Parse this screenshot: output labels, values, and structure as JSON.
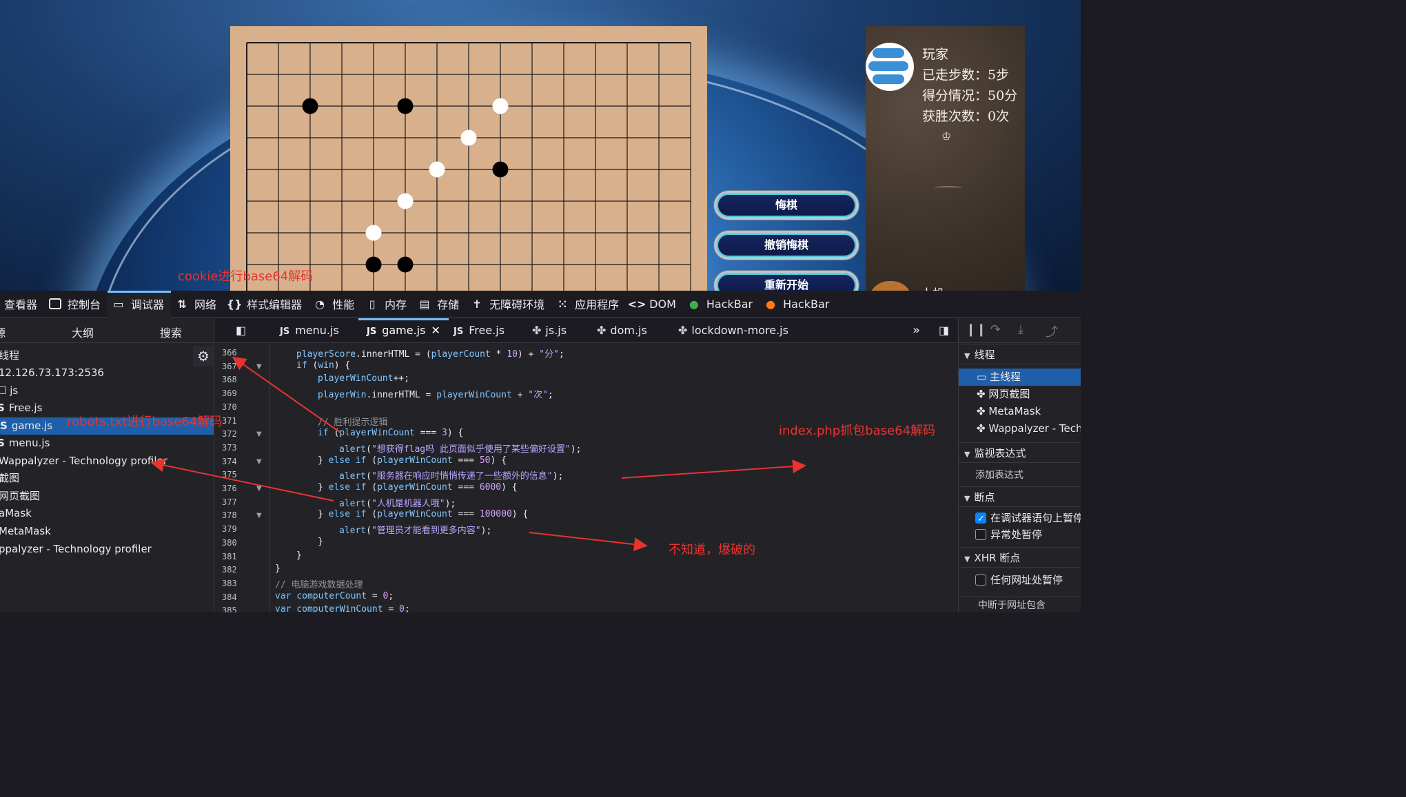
{
  "game": {
    "player_stats": {
      "title": "玩家",
      "steps": "已走步数：5步",
      "score": "得分情况：50分",
      "wins": "获胜次数：0次",
      "ai_label": "人机"
    },
    "buttons": {
      "undo": "悔棋",
      "cancel_undo": "撤销悔棋",
      "restart": "重新开始"
    },
    "board": {
      "grid_lines": 15,
      "black_stones": [
        [
          2,
          2
        ],
        [
          4,
          7
        ],
        [
          5,
          2
        ],
        [
          5,
          7
        ],
        [
          8,
          4
        ]
      ],
      "white_stones": [
        [
          4,
          6
        ],
        [
          5,
          5
        ],
        [
          6,
          4
        ],
        [
          7,
          3
        ],
        [
          8,
          2
        ]
      ]
    }
  },
  "annotations": {
    "cookie": "cookie进行base64解码",
    "robots": "robots.txt进行base64解码",
    "index": "index.php抓包base64解码",
    "unknown": "不知道，爆破的"
  },
  "devtools": {
    "toolbox": {
      "inspector": "查看器",
      "console": "控制台",
      "debugger": "调试器",
      "network": "网络",
      "style_editor": "样式编辑器",
      "performance": "性能",
      "memory": "内存",
      "storage": "存储",
      "accessibility": "无障碍环境",
      "application": "应用程序",
      "dom": "DOM",
      "hackbar1": "HackBar",
      "hackbar2": "HackBar"
    },
    "sources": {
      "tab_source": "源",
      "tab_outline": "大纲",
      "tab_search": "搜索",
      "tree": [
        "线程",
        "12.126.73.173:2536",
        "js",
        "Free.js",
        "game.js",
        "menu.js",
        "Wappalyzer - Technology profiler",
        "截图",
        "网页截图",
        "aMask",
        "MetaMask",
        "ppalyzer - Technology profiler"
      ]
    },
    "editor": {
      "tabs": [
        "menu.js",
        "game.js",
        "Free.js",
        "js.js",
        "dom.js",
        "lockdown-more.js"
      ],
      "lines": [
        "366",
        "367",
        "368",
        "369",
        "370",
        "371",
        "372",
        "373",
        "374",
        "375",
        "376",
        "377",
        "378",
        "379",
        "380",
        "381",
        "382",
        "383",
        "384",
        "385"
      ],
      "code": {
        "l366a": "playerScore",
        "l366b": ".innerHTML = (",
        "l366c": "playerCount",
        "l366d": " * ",
        "l366e": "10",
        "l366f": ") + ",
        "l366g": "\"分\"",
        "l367a": "if",
        "l367b": " (",
        "l367c": "win",
        "l367d": ") {",
        "l368a": "playerWinCount",
        "l368b": "++;",
        "l369a": "playerWin",
        "l369b": ".innerHTML = ",
        "l369c": "playerWinCount",
        "l369d": " + ",
        "l369e": "\"次\"",
        "l371": "// 胜利提示逻辑",
        "l372a": "if",
        "l372b": " (",
        "l372c": "playerWinCount",
        "l372d": " === ",
        "l372e": "3",
        "l372f": ") {",
        "l373a": "alert",
        "l373b": "(",
        "l373c": "\"想获得flag吗 此页面似乎使用了某些偏好设置\"",
        "l373d": ");",
        "l374a": "} ",
        "l374b": "else if",
        "l374c": " (",
        "l374d": "playerWinCount",
        "l374e": " === ",
        "l374f": "50",
        "l374g": ") {",
        "l375a": "alert",
        "l375b": "(",
        "l375c": "\"服务器在响应时悄悄传递了一些额外的信息\"",
        "l375d": ");",
        "l376a": "} ",
        "l376b": "else if",
        "l376c": " (",
        "l376d": "playerWinCount",
        "l376e": " === ",
        "l376f": "6000",
        "l376g": ") {",
        "l377a": "alert",
        "l377b": "(",
        "l377c": "\"人机是机器人哦\"",
        "l377d": ");",
        "l378a": "} ",
        "l378b": "else if",
        "l378c": " (",
        "l378d": "playerWinCount",
        "l378e": " === ",
        "l378f": "100000",
        "l378g": ") {",
        "l379a": "alert",
        "l379b": "(",
        "l379c": "\"管理员才能看到更多内容\"",
        "l379d": ");",
        "l380": "}",
        "l381": "}",
        "l382": "}",
        "l383": "// 电脑游戏数据处理",
        "l384a": "var",
        "l384b": " computerCount",
        "l384c": " = ",
        "l384d": "0",
        "l384e": ";",
        "l385a": "var",
        "l385b": " computerWinCount",
        "l385c": " = ",
        "l385d": "0",
        "l385e": ";"
      }
    },
    "debugger_panel": {
      "threads": "线程",
      "main_thread": "主线程",
      "screenshot": "网页截图",
      "metamask": "MetaMask",
      "wappalyzer": "Wappalyzer - Techn",
      "watch": "监视表达式",
      "add_watch": "添加表达式",
      "breakpoints": "断点",
      "pause_debugger": "在调试器语句上暂停",
      "pause_exceptions": "异常处暂停",
      "xhr": "XHR 断点",
      "any_url": "任何网址处暂停",
      "dom_mutation": "中断于网址包含"
    }
  }
}
